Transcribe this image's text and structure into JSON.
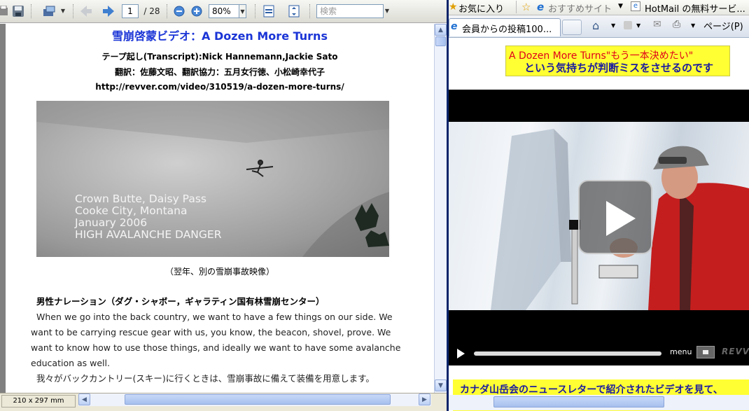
{
  "pdf": {
    "toolbar": {
      "page_current": "1",
      "page_total": "/ 28",
      "zoom": "80%",
      "search_placeholder": "検索"
    },
    "page": {
      "title": "雪崩啓蒙ビデオ：A Dozen More Turns",
      "transcript_line": "テープ起し(Transcript):Nick Hannemann,Jackie Sato",
      "translation_line": "翻訳：佐藤文昭、翻訳協力：五月女行徳、小松崎幸代子",
      "url_line": "http://revver.com/video/310519/a-dozen-more-turns/",
      "video_overlay": [
        "Crown Butte, Daisy Pass",
        "Cooke City, Montana",
        "January 2006",
        "HIGH AVALANCHE DANGER"
      ],
      "caption": "（翌年、別の雪崩事故映像）",
      "speaker": "男性ナレーション（ダグ・シャボー，ギャラティン国有林雪崩センター）",
      "para1": [
        "When  we  go  into  the  back  country,  we  want  to  have  a  few  things  on  our  side.   We",
        "want  to  be  carrying  rescue  gear  with  us,  you  know,  the  beacon,  shovel,  prove.   We",
        "want to know how to use those things, and ideally we want to have some avalanche",
        "education as well."
      ],
      "para2": "我々がバックカントリー(スキー)に行くときは、雪崩事故に備えて装備を用意します。"
    },
    "status": {
      "page_size": "210 x 297 mm"
    }
  },
  "ie": {
    "favorites": {
      "favorites_label": "お気に入り",
      "suggested_sites": "おすすめサイト",
      "hotmail": "HotMail の無料サービ..."
    },
    "tabs": {
      "active_tab": "会員からの投稿100...",
      "page_menu": "ページ(P)"
    },
    "content": {
      "banner_line1": "A Dozen More Turns\"もう一本決めたい\"",
      "banner_line2": "という気持ちが判断ミスをさせるのです",
      "video_menu": "menu",
      "video_brand": "REVVER",
      "bottom_note": "カナダ山岳会のニュースレターで紹介されたビデオを見て、"
    }
  },
  "colors": {
    "title_blue": "#1b35d6",
    "banner_yellow": "#ffff33",
    "banner_red": "#e0001a",
    "banner_blue": "#1a1aa0"
  }
}
